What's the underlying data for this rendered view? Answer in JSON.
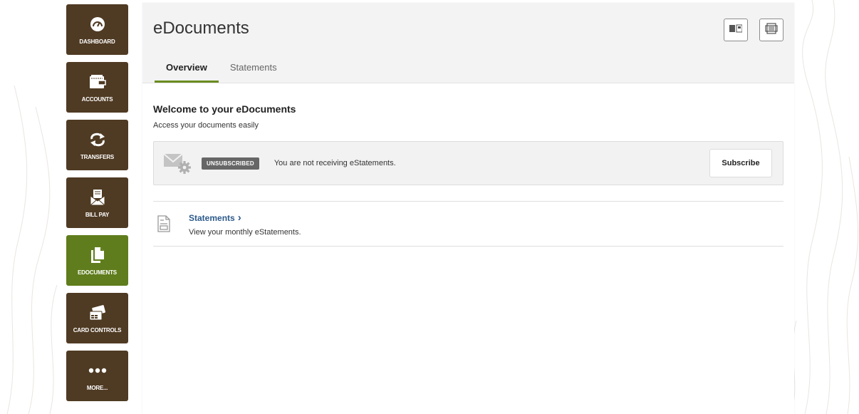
{
  "sidebar": {
    "items": [
      {
        "label": "DASHBOARD",
        "icon": "dashboard-gauge-icon",
        "active": false
      },
      {
        "label": "ACCOUNTS",
        "icon": "wallet-icon",
        "active": false
      },
      {
        "label": "TRANSFERS",
        "icon": "transfer-arrows-icon",
        "active": false
      },
      {
        "label": "BILL PAY",
        "icon": "bill-envelope-icon",
        "active": false
      },
      {
        "label": "EDOCUMENTS",
        "icon": "documents-icon",
        "active": true
      },
      {
        "label": "CARD CONTROLS",
        "icon": "card-controls-icon",
        "active": false
      },
      {
        "label": "MORE...",
        "icon": "more-dots-icon",
        "active": false
      }
    ]
  },
  "header": {
    "title": "eDocuments",
    "buttons": [
      {
        "icon": "layout-columns-icon"
      },
      {
        "icon": "print-preview-icon"
      }
    ]
  },
  "tabs": [
    {
      "label": "Overview",
      "active": true
    },
    {
      "label": "Statements",
      "active": false
    }
  ],
  "welcome": {
    "title": "Welcome to your eDocuments",
    "subtitle": "Access your documents easily"
  },
  "subscription": {
    "status_badge": "UNSUBSCRIBED",
    "message": "You are not receiving eStatements.",
    "button_label": "Subscribe",
    "icon": "mail-settings-icon"
  },
  "statements": {
    "link_label": "Statements",
    "link_chevron": "›",
    "description": "View your monthly eStatements.",
    "icon": "document-icon"
  },
  "colors": {
    "sidebar_bg": "#4f3a23",
    "sidebar_active": "#5f7d1c",
    "tab_underline": "#6a8c1f",
    "link": "#2c5a8a",
    "badge_bg": "#666666"
  }
}
